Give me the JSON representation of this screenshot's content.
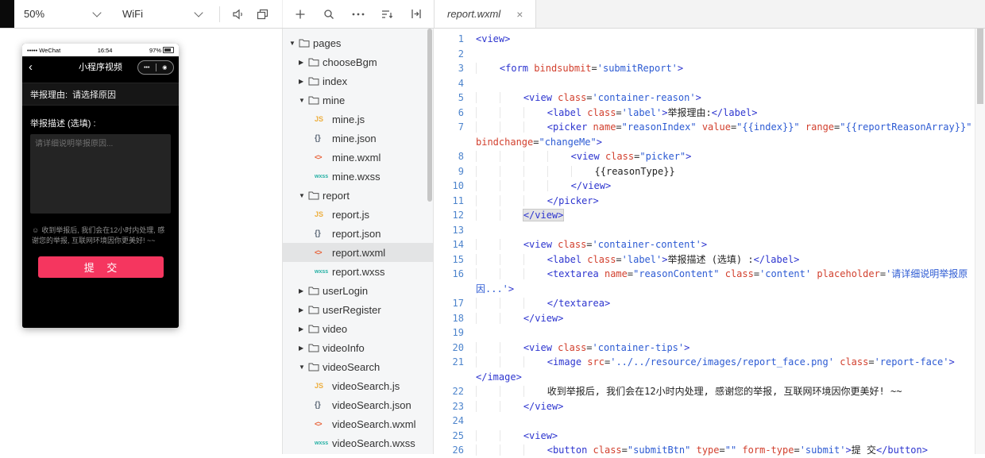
{
  "toolbar": {
    "zoom_value": "50%",
    "network_value": "WiFi",
    "icons": {
      "volume": "speaker",
      "panels": "overlapping-windows",
      "add": "plus",
      "search": "magnifier",
      "more": "ellipsis",
      "sort": "sort-lines",
      "compile": "compile-mode"
    }
  },
  "editor_tab": {
    "title": "report.wxml",
    "close": "×"
  },
  "simulator": {
    "status": {
      "carrier": "••••• WeChat",
      "time": "16:54",
      "battery": "97%"
    },
    "nav": {
      "back": "‹",
      "title": "小程序视频",
      "menu": "•••",
      "record": "◉"
    },
    "screen": {
      "reason_label": "举报理由:",
      "reason_value": "请选择原因",
      "desc_label": "举报描述 (选填) :",
      "textarea_placeholder": "请详细说明举报原因...",
      "tips_face": "☺",
      "tips": "收到举报后, 我们会在12小时内处理, 感谢您的举报, 互联网环境因你更美好! ~~",
      "submit_label": "提 交",
      "accent_color": "#f5365f"
    }
  },
  "filetree": {
    "icon_labels": {
      "js": "JS",
      "json": "{}",
      "wxml": "<>",
      "wxss": "wxss"
    },
    "items": [
      {
        "label": "pages",
        "type": "folder",
        "depth": 0,
        "expanded": true
      },
      {
        "label": "chooseBgm",
        "type": "folder",
        "depth": 1,
        "expanded": false
      },
      {
        "label": "index",
        "type": "folder",
        "depth": 1,
        "expanded": false
      },
      {
        "label": "mine",
        "type": "folder",
        "depth": 1,
        "expanded": true
      },
      {
        "label": "mine.js",
        "type": "js",
        "depth": 2
      },
      {
        "label": "mine.json",
        "type": "json",
        "depth": 2
      },
      {
        "label": "mine.wxml",
        "type": "wxml",
        "depth": 2
      },
      {
        "label": "mine.wxss",
        "type": "wxss",
        "depth": 2
      },
      {
        "label": "report",
        "type": "folder",
        "depth": 1,
        "expanded": true
      },
      {
        "label": "report.js",
        "type": "js",
        "depth": 2
      },
      {
        "label": "report.json",
        "type": "json",
        "depth": 2
      },
      {
        "label": "report.wxml",
        "type": "wxml",
        "depth": 2,
        "selected": true
      },
      {
        "label": "report.wxss",
        "type": "wxss",
        "depth": 2
      },
      {
        "label": "userLogin",
        "type": "folder",
        "depth": 1,
        "expanded": false
      },
      {
        "label": "userRegister",
        "type": "folder",
        "depth": 1,
        "expanded": false
      },
      {
        "label": "video",
        "type": "folder",
        "depth": 1,
        "expanded": false
      },
      {
        "label": "videoInfo",
        "type": "folder",
        "depth": 1,
        "expanded": false
      },
      {
        "label": "videoSearch",
        "type": "folder",
        "depth": 1,
        "expanded": true
      },
      {
        "label": "videoSearch.js",
        "type": "js",
        "depth": 2
      },
      {
        "label": "videoSearch.json",
        "type": "json",
        "depth": 2
      },
      {
        "label": "videoSearch.wxml",
        "type": "wxml",
        "depth": 2
      },
      {
        "label": "videoSearch.wxss",
        "type": "wxss",
        "depth": 2
      }
    ]
  },
  "editor": {
    "lines": [
      {
        "n": 1,
        "i": 0,
        "s": [
          [
            "t",
            "<view>"
          ]
        ]
      },
      {
        "n": 2,
        "i": 0,
        "s": []
      },
      {
        "n": 3,
        "i": 1,
        "s": [
          [
            "t",
            "<form "
          ],
          [
            "a",
            "bindsubmit"
          ],
          [
            "p",
            "="
          ],
          [
            "s",
            "'submitReport'"
          ],
          [
            "t",
            ">"
          ]
        ]
      },
      {
        "n": 4,
        "i": 0,
        "s": []
      },
      {
        "n": 5,
        "i": 2,
        "s": [
          [
            "t",
            "<view "
          ],
          [
            "a",
            "class"
          ],
          [
            "p",
            "="
          ],
          [
            "s",
            "'container-reason'"
          ],
          [
            "t",
            ">"
          ]
        ]
      },
      {
        "n": 6,
        "i": 3,
        "s": [
          [
            "t",
            "<label "
          ],
          [
            "a",
            "class"
          ],
          [
            "p",
            "="
          ],
          [
            "s",
            "'label'"
          ],
          [
            "t",
            ">"
          ],
          [
            "x",
            "举报理由:"
          ],
          [
            "t",
            "</label>"
          ]
        ]
      },
      {
        "n": 7,
        "i": 3,
        "s": [
          [
            "t",
            "<picker "
          ],
          [
            "a",
            "name"
          ],
          [
            "p",
            "="
          ],
          [
            "s",
            "\"reasonIndex\""
          ],
          [
            "p",
            " "
          ],
          [
            "a",
            "value"
          ],
          [
            "p",
            "="
          ],
          [
            "s",
            "\"{{index}}\""
          ],
          [
            "p",
            " "
          ],
          [
            "a",
            "range"
          ],
          [
            "p",
            "="
          ],
          [
            "s",
            "\"{{reportReasonArray}}\""
          ],
          [
            "p",
            " "
          ],
          [
            "a",
            "bindchange"
          ],
          [
            "p",
            "="
          ],
          [
            "s",
            "\"changeMe\""
          ],
          [
            "t",
            ">"
          ]
        ]
      },
      {
        "n": 8,
        "i": 4,
        "s": [
          [
            "t",
            "<view "
          ],
          [
            "a",
            "class"
          ],
          [
            "p",
            "="
          ],
          [
            "s",
            "\"picker\""
          ],
          [
            "t",
            ">"
          ]
        ]
      },
      {
        "n": 9,
        "i": 5,
        "s": [
          [
            "x",
            "{{reasonType}}"
          ]
        ]
      },
      {
        "n": 10,
        "i": 4,
        "s": [
          [
            "t",
            "</view>"
          ]
        ]
      },
      {
        "n": 11,
        "i": 3,
        "s": [
          [
            "t",
            "</picker>"
          ]
        ]
      },
      {
        "n": 12,
        "i": 2,
        "s": [
          [
            "th",
            "</view>"
          ]
        ]
      },
      {
        "n": 13,
        "i": 0,
        "s": []
      },
      {
        "n": 14,
        "i": 2,
        "s": [
          [
            "t",
            "<view "
          ],
          [
            "a",
            "class"
          ],
          [
            "p",
            "="
          ],
          [
            "s",
            "'container-content'"
          ],
          [
            "t",
            ">"
          ]
        ]
      },
      {
        "n": 15,
        "i": 3,
        "s": [
          [
            "t",
            "<label "
          ],
          [
            "a",
            "class"
          ],
          [
            "p",
            "="
          ],
          [
            "s",
            "'label'"
          ],
          [
            "t",
            ">"
          ],
          [
            "x",
            "举报描述 (选填) :"
          ],
          [
            "t",
            "</label>"
          ]
        ]
      },
      {
        "n": 16,
        "i": 3,
        "s": [
          [
            "t",
            "<textarea "
          ],
          [
            "a",
            "name"
          ],
          [
            "p",
            "="
          ],
          [
            "s",
            "\"reasonContent\""
          ],
          [
            "p",
            " "
          ],
          [
            "a",
            "class"
          ],
          [
            "p",
            "="
          ],
          [
            "s",
            "'content'"
          ],
          [
            "p",
            " "
          ],
          [
            "a",
            "placeholder"
          ],
          [
            "p",
            "="
          ],
          [
            "s",
            "'请详细说明举报原因...'"
          ],
          [
            "t",
            ">"
          ]
        ]
      },
      {
        "n": 17,
        "i": 3,
        "s": [
          [
            "t",
            "</textarea>"
          ]
        ]
      },
      {
        "n": 18,
        "i": 2,
        "s": [
          [
            "t",
            "</view>"
          ]
        ]
      },
      {
        "n": 19,
        "i": 0,
        "s": []
      },
      {
        "n": 20,
        "i": 2,
        "s": [
          [
            "t",
            "<view "
          ],
          [
            "a",
            "class"
          ],
          [
            "p",
            "="
          ],
          [
            "s",
            "'container-tips'"
          ],
          [
            "t",
            ">"
          ]
        ]
      },
      {
        "n": 21,
        "i": 3,
        "s": [
          [
            "t",
            "<image "
          ],
          [
            "a",
            "src"
          ],
          [
            "p",
            "="
          ],
          [
            "s",
            "'../../resource/images/report_face.png'"
          ],
          [
            "p",
            " "
          ],
          [
            "a",
            "class"
          ],
          [
            "p",
            "="
          ],
          [
            "s",
            "'report-face'"
          ],
          [
            "t",
            "></image>"
          ]
        ]
      },
      {
        "n": 22,
        "i": 3,
        "s": [
          [
            "x",
            "收到举报后, 我们会在12小时内处理, 感谢您的举报, 互联网环境因你更美好! ~~"
          ]
        ]
      },
      {
        "n": 23,
        "i": 2,
        "s": [
          [
            "t",
            "</view>"
          ]
        ]
      },
      {
        "n": 24,
        "i": 0,
        "s": []
      },
      {
        "n": 25,
        "i": 2,
        "s": [
          [
            "t",
            "<view>"
          ]
        ]
      },
      {
        "n": 26,
        "i": 3,
        "s": [
          [
            "t",
            "<button "
          ],
          [
            "a",
            "class"
          ],
          [
            "p",
            "="
          ],
          [
            "s",
            "\"submitBtn\""
          ],
          [
            "p",
            " "
          ],
          [
            "a",
            "type"
          ],
          [
            "p",
            "="
          ],
          [
            "s",
            "\"\""
          ],
          [
            "p",
            " "
          ],
          [
            "a",
            "form-type"
          ],
          [
            "p",
            "="
          ],
          [
            "s",
            "'submit'"
          ],
          [
            "t",
            ">"
          ],
          [
            "x",
            "提 交"
          ],
          [
            "t",
            "</button>"
          ]
        ]
      }
    ]
  }
}
